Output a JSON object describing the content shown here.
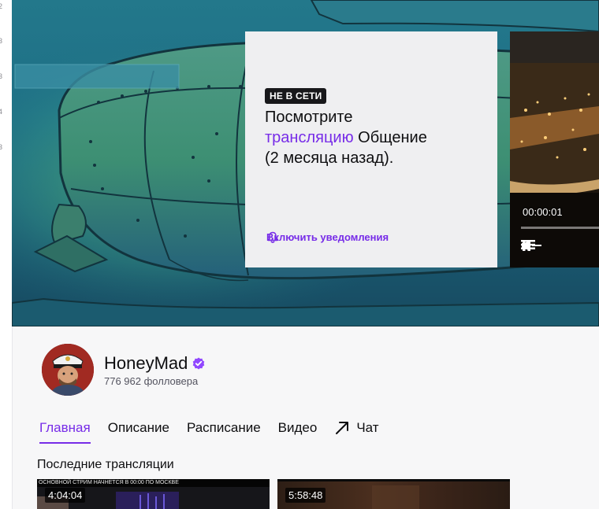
{
  "left_rail": {
    "numbers": [
      "2",
      "3",
      "3",
      "4",
      "3"
    ]
  },
  "offline_card": {
    "badge": "НЕ В СЕТИ",
    "text_before": "Посмотрите",
    "link_text": "трансляцию",
    "text_after": "Общение",
    "text_end": "(2 месяца назад).",
    "notify_label": "Включить уведомления"
  },
  "player": {
    "time": "00:00:01"
  },
  "channel": {
    "name": "HoneyMad",
    "followers": "776 962 фолловера",
    "verified": true
  },
  "tabs": [
    {
      "label": "Главная",
      "active": true
    },
    {
      "label": "Описание",
      "active": false
    },
    {
      "label": "Расписание",
      "active": false
    },
    {
      "label": "Видео",
      "active": false
    },
    {
      "label": "Чат",
      "active": false,
      "icon": "external-arrow-icon"
    }
  ],
  "recent": {
    "title": "Последние трансляции",
    "items": [
      {
        "duration": "4:04:04",
        "top_text": "ОСНОВНОЙ СТРИМ НАЧНЕТСЯ В 00:00 ПО МОСКВЕ"
      },
      {
        "duration": "5:58:48"
      }
    ]
  },
  "colors": {
    "accent": "#772ce8",
    "badge_bg": "#18181b",
    "banner": "#1e6f86"
  }
}
